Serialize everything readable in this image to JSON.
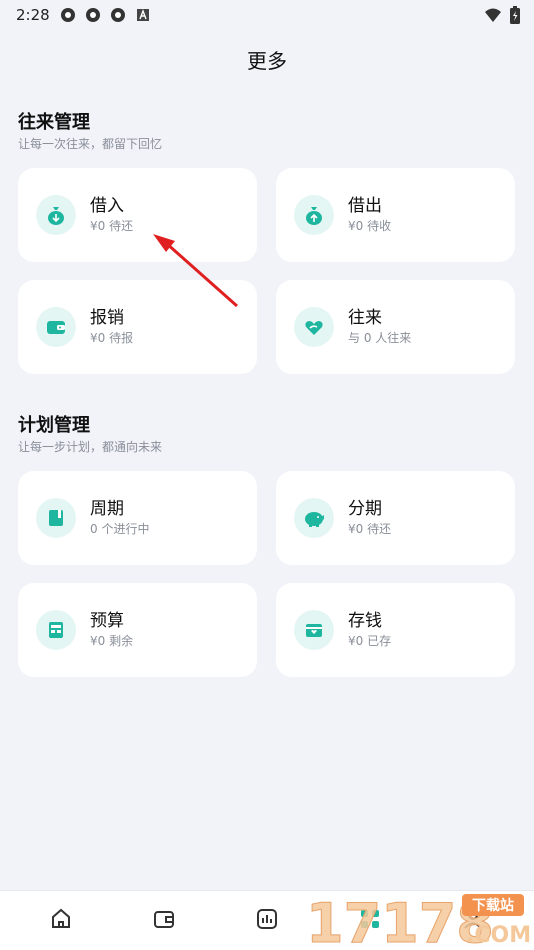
{
  "status_bar": {
    "time": "2:28",
    "icons": [
      "app-icon",
      "app-icon",
      "app-icon",
      "a-icon"
    ],
    "right_icons": [
      "wifi-icon",
      "battery-icon"
    ]
  },
  "page": {
    "title": "更多"
  },
  "section1": {
    "title": "往来管理",
    "subtitle": "让每一次往来，都留下回忆",
    "cards": [
      {
        "name": "借入",
        "meta": "¥0 待还",
        "icon": "money-bag-down-icon"
      },
      {
        "name": "借出",
        "meta": "¥0 待收",
        "icon": "money-bag-up-icon"
      },
      {
        "name": "报销",
        "meta": "¥0 待报",
        "icon": "wallet-icon"
      },
      {
        "name": "往来",
        "meta": "与 0 人往来",
        "icon": "heart-hand-icon"
      }
    ]
  },
  "section2": {
    "title": "计划管理",
    "subtitle": "让每一步计划，都通向未来",
    "cards": [
      {
        "name": "周期",
        "meta": "0 个进行中",
        "icon": "notebook-icon"
      },
      {
        "name": "分期",
        "meta": "¥0 待还",
        "icon": "piggy-bank-icon"
      },
      {
        "name": "预算",
        "meta": "¥0 剩余",
        "icon": "calculator-icon"
      },
      {
        "name": "存钱",
        "meta": "¥0 已存",
        "icon": "savings-card-icon"
      }
    ]
  },
  "bottom_nav": [
    "home-icon",
    "wallet-icon",
    "chart-icon",
    "grid-icon",
    "user-icon"
  ],
  "watermark": {
    "brand": "17178",
    "domain": ".COM",
    "tag": "下载站"
  },
  "colors": {
    "accent": "#1fb69f",
    "accent_bg": "#e4f6f3",
    "background": "#f1f3f9",
    "arrow": "#e02020"
  }
}
